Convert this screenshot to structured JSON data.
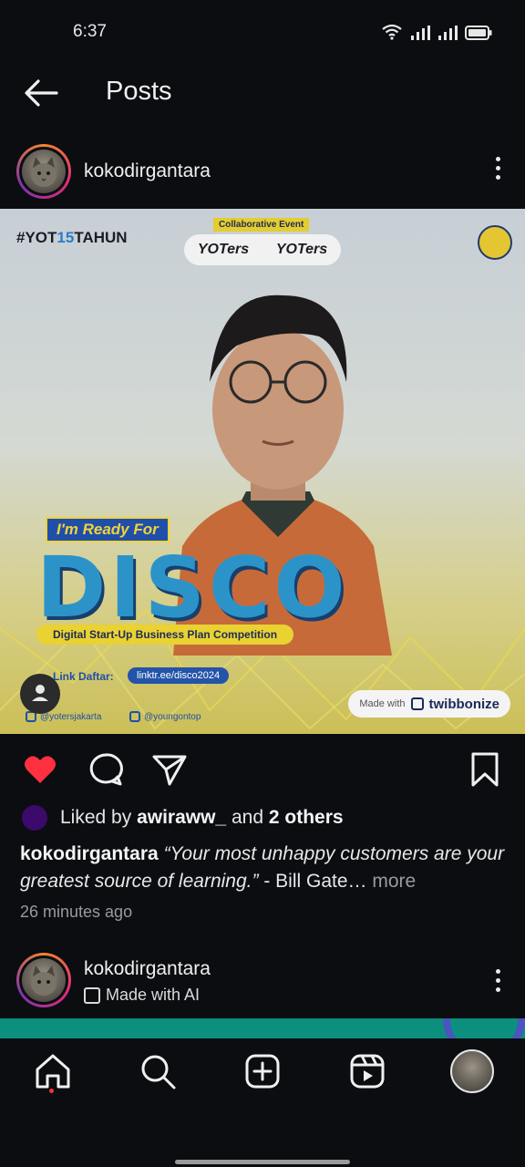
{
  "status_bar": {
    "time": "6:37"
  },
  "appbar": {
    "title": "Posts"
  },
  "post": {
    "username": "kokodirgantara",
    "image": {
      "hashtag_prefix": "#YOT",
      "hashtag_highlight": "15",
      "hashtag_suffix": "TAHUN",
      "collab_label": "Collaborative Event",
      "yot_left": "YOTers",
      "yot_right": "YOTers",
      "ready_label": "I'm Ready For",
      "headline": "DISCO",
      "subtitle": "Digital Start-Up Business Plan Competition",
      "link_label": "Link Daftar:",
      "link_value": "linktr.ee/disco2024",
      "handle_1": "@yotersjakarta",
      "handle_2": "@youngontop",
      "made_with_label": "Made with",
      "made_with_brand": "twibbonize"
    },
    "likes": {
      "prefix": "Liked by",
      "user": "awiraww_",
      "middle": "and",
      "others": "2 others"
    },
    "caption": {
      "user": "kokodirgantara",
      "quote": "“Your most unhappy customers are your greatest source of learning.”",
      "tail": " - Bill Gate…",
      "more": "more"
    },
    "timestamp": "26 minutes ago"
  },
  "post2": {
    "username": "kokodirgantara",
    "subtitle": "Made with AI"
  },
  "colors": {
    "background": "#0b0d11",
    "like_red": "#ff3040",
    "accent_teal": "#0d8f7e"
  }
}
